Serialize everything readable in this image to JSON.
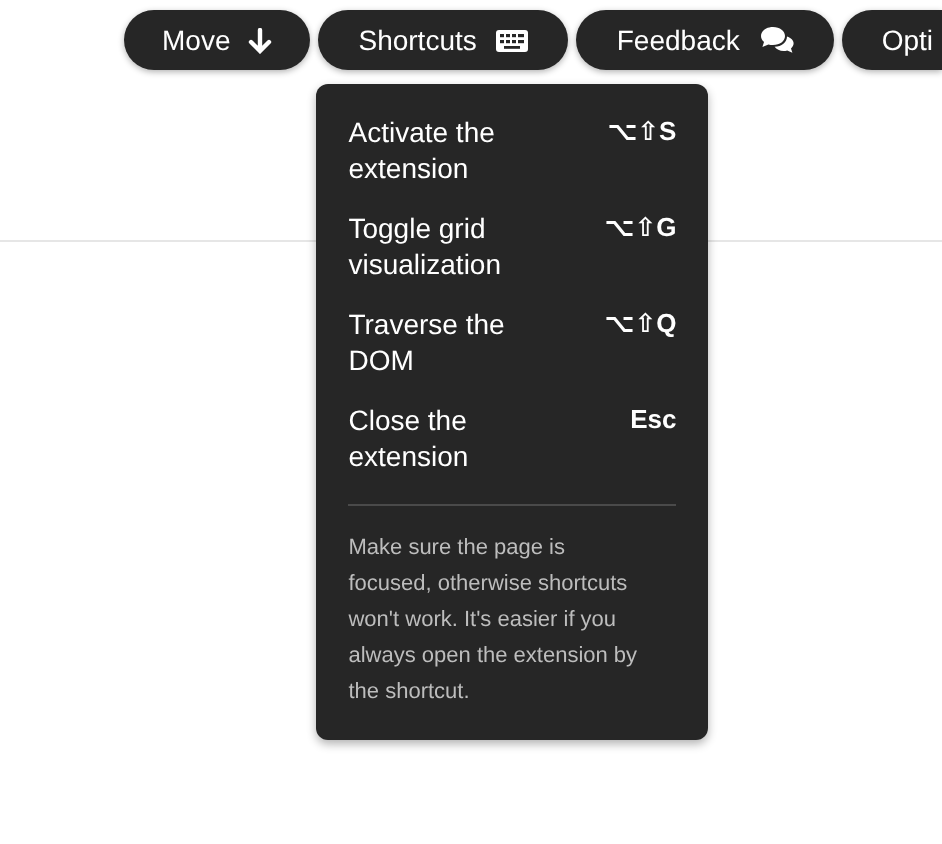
{
  "toolbar": [
    {
      "label": "Move"
    },
    {
      "label": "Shortcuts"
    },
    {
      "label": "Feedback"
    },
    {
      "label": "Opti"
    }
  ],
  "shortcuts_menu": {
    "items": [
      {
        "action": "Activate the extension",
        "keys": "⌥⇧S"
      },
      {
        "action": "Toggle grid visualization",
        "keys": "⌥⇧G"
      },
      {
        "action": "Traverse the DOM",
        "keys": "⌥⇧Q"
      },
      {
        "action": "Close the extension",
        "keys": "Esc"
      }
    ],
    "note": "Make sure the page is focused, otherwise shortcuts won't work. It's easier if you always open the extension by the shortcut."
  }
}
